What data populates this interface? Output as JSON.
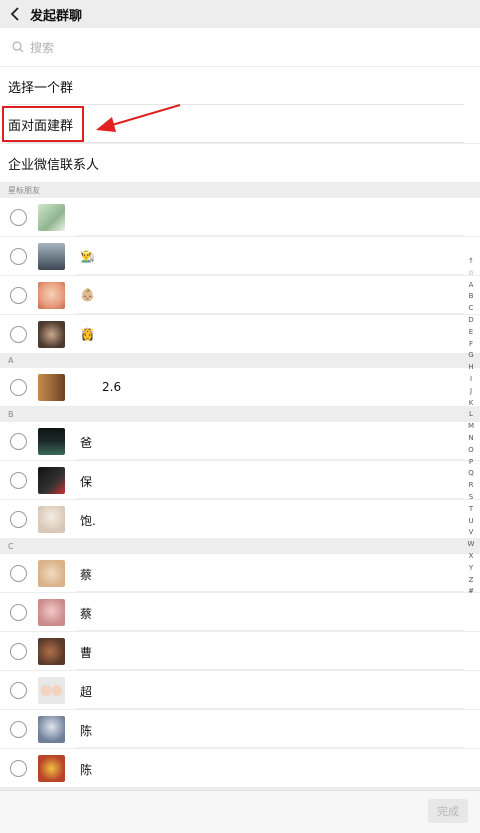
{
  "header": {
    "title": "发起群聊"
  },
  "search": {
    "placeholder": "搜索"
  },
  "entries": [
    "选择一个群",
    "面对面建群",
    "企业微信联系人"
  ],
  "sections": [
    "星标朋友",
    "A",
    "B",
    "C"
  ],
  "contacts": [
    {
      "name": "",
      "color": "#8fb58f"
    },
    {
      "name": "👨‍🌾",
      "color": "#6b7a88"
    },
    {
      "name": "👶🏼",
      "color": "#e79a7c"
    },
    {
      "name": "👸",
      "color": "#4e3a2e"
    },
    {
      "name": "2.6",
      "color": "#9c6a3a"
    },
    {
      "name": "爸",
      "color": "#1c2a2a"
    },
    {
      "name": "保",
      "color": "#333333"
    },
    {
      "name": "饱.",
      "color": "#d8c7b7"
    },
    {
      "name": "蔡",
      "color": "#d9b28a"
    },
    {
      "name": "蔡",
      "color": "#c98a8a"
    },
    {
      "name": "曹",
      "color": "#5a3a2a"
    },
    {
      "name": "超",
      "color": "#e8e8e8"
    },
    {
      "name": "陈",
      "color": "#6f7f9a"
    },
    {
      "name": "陈",
      "color": "#b8452a"
    }
  ],
  "index": [
    "↑",
    "☆",
    "A",
    "B",
    "C",
    "D",
    "E",
    "F",
    "G",
    "H",
    "I",
    "J",
    "K",
    "L",
    "M",
    "N",
    "O",
    "P",
    "Q",
    "R",
    "S",
    "T",
    "U",
    "V",
    "W",
    "X",
    "Y",
    "Z",
    "#"
  ],
  "footer": {
    "done_label": "完成"
  },
  "colors": {
    "annotation_red": "#e02020"
  }
}
